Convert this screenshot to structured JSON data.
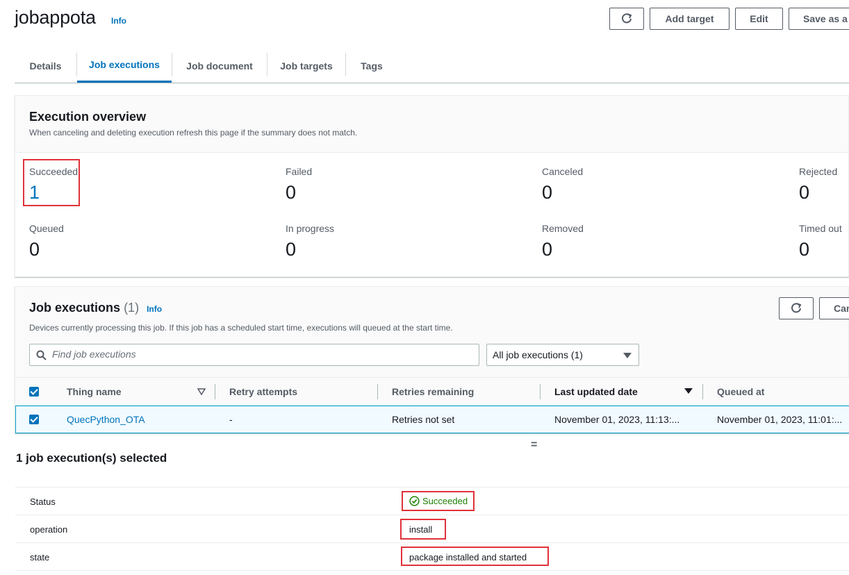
{
  "header": {
    "title": "jobappota",
    "info_label": "Info",
    "buttons": {
      "add_target": "Add target",
      "edit": "Edit",
      "save_as": "Save as a"
    }
  },
  "tabs": [
    {
      "label": "Details",
      "active": false
    },
    {
      "label": "Job executions",
      "active": true
    },
    {
      "label": "Job document",
      "active": false
    },
    {
      "label": "Job targets",
      "active": false
    },
    {
      "label": "Tags",
      "active": false
    }
  ],
  "overview": {
    "title": "Execution overview",
    "description": "When canceling and deleting execution refresh this page if the summary does not match.",
    "stats": [
      {
        "label": "Succeeded",
        "value": "1"
      },
      {
        "label": "Failed",
        "value": "0"
      },
      {
        "label": "Canceled",
        "value": "0"
      },
      {
        "label": "Rejected",
        "value": "0"
      },
      {
        "label": "Queued",
        "value": "0"
      },
      {
        "label": "In progress",
        "value": "0"
      },
      {
        "label": "Removed",
        "value": "0"
      },
      {
        "label": "Timed out",
        "value": "0"
      }
    ]
  },
  "executions": {
    "title": "Job executions",
    "count": "(1)",
    "info_label": "Info",
    "description": "Devices currently processing this job. If this job has a scheduled start time, executions will queued at the start time.",
    "cancel_label": "Can",
    "search_placeholder": "Find job executions",
    "filter_value": "All job executions (1)",
    "columns": [
      "Thing name",
      "Retry attempts",
      "Retries remaining",
      "Last updated date",
      "Queued at"
    ],
    "rows": [
      {
        "thing_name": "QuecPython_OTA",
        "retry_attempts": "-",
        "retries_remaining": "Retries not set",
        "last_updated": "November 01, 2023, 11:13:...",
        "queued_at": "November 01, 2023, 11:01:..."
      }
    ]
  },
  "selection": {
    "title": "1 job execution(s) selected",
    "details": [
      {
        "key": "Status",
        "value": "Succeeded"
      },
      {
        "key": "operation",
        "value": "install"
      },
      {
        "key": "state",
        "value": "package installed and started"
      }
    ],
    "divider_glyph": "="
  },
  "colors": {
    "link": "#0073bb",
    "success": "#1d8102",
    "highlight": "#e0313a"
  }
}
